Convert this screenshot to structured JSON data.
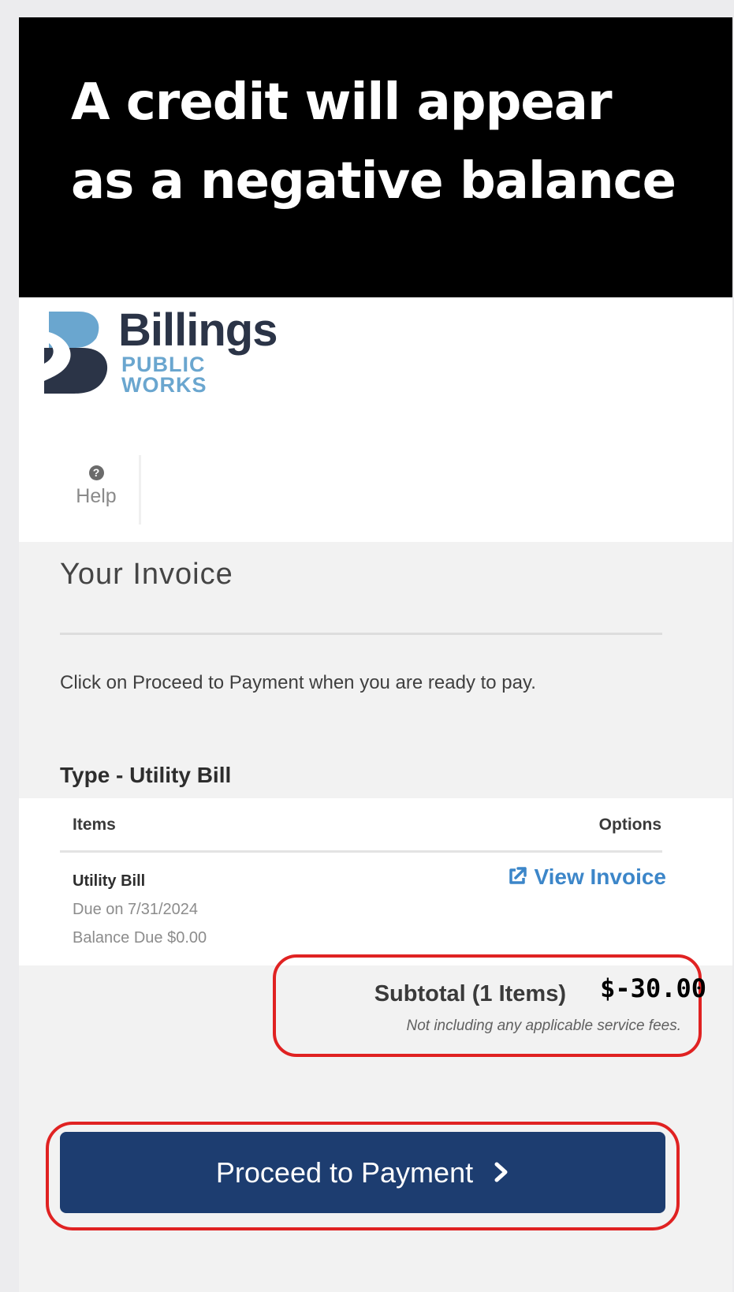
{
  "banner": {
    "text": "A credit will appear as a negative balance"
  },
  "logo": {
    "name": "Billings",
    "sub_line1": "PUBLIC",
    "sub_line2": "WORKS"
  },
  "nav": {
    "help_icon": "?",
    "help_label": "Help"
  },
  "invoice": {
    "title": "Your Invoice",
    "instructions": "Click on Proceed to Payment when you are ready to pay.",
    "type_label": "Type - Utility Bill",
    "columns": {
      "items": "Items",
      "options": "Options"
    },
    "item": {
      "name": "Utility Bill",
      "due": "Due on 7/31/2024",
      "balance": "Balance Due $0.00",
      "view_invoice": "View Invoice"
    },
    "subtotal_label": "Subtotal (1 Items)",
    "subtotal_amount": "$-30.00",
    "fee_note": "Not including any applicable service fees."
  },
  "actions": {
    "proceed_label": "Proceed to Payment"
  },
  "colors": {
    "primary_button": "#1d3d70",
    "link": "#3c86c9",
    "highlight_outline": "#e02222",
    "logo_dark": "#2b3447",
    "logo_light": "#6aa6cf"
  },
  "icons": {
    "logo": "billings-b-logo-icon",
    "help": "question-circle-icon",
    "external": "external-link-icon",
    "chevron": "chevron-right-icon"
  }
}
